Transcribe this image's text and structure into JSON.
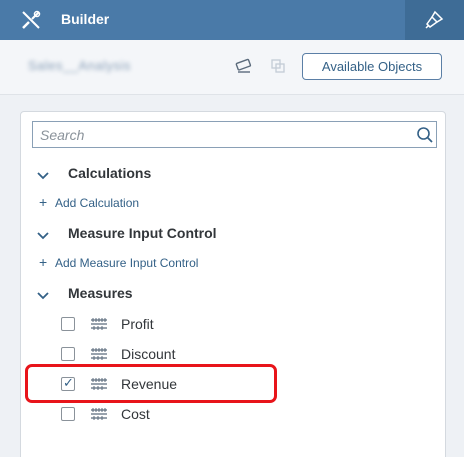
{
  "header": {
    "title": "Builder",
    "icons": {
      "left": "tools-icon",
      "right": "paint-brush-icon"
    }
  },
  "toolbar": {
    "model_name": "Sales__Analysis",
    "available_objects_label": "Available Objects",
    "icons": [
      "eraser-icon",
      "copy-icon"
    ]
  },
  "search": {
    "placeholder": "Search"
  },
  "sections": [
    {
      "label": "Calculations",
      "add_label": "Add Calculation"
    },
    {
      "label": "Measure Input Control",
      "add_label": "Add Measure Input Control"
    },
    {
      "label": "Measures"
    }
  ],
  "measures": [
    {
      "name": "Profit",
      "checked": false
    },
    {
      "name": "Discount",
      "checked": false
    },
    {
      "name": "Revenue",
      "checked": true
    },
    {
      "name": "Cost",
      "checked": false
    }
  ],
  "colors": {
    "header_bg": "#4a7aa8",
    "accent": "#346187",
    "highlight": "#e8141a"
  }
}
